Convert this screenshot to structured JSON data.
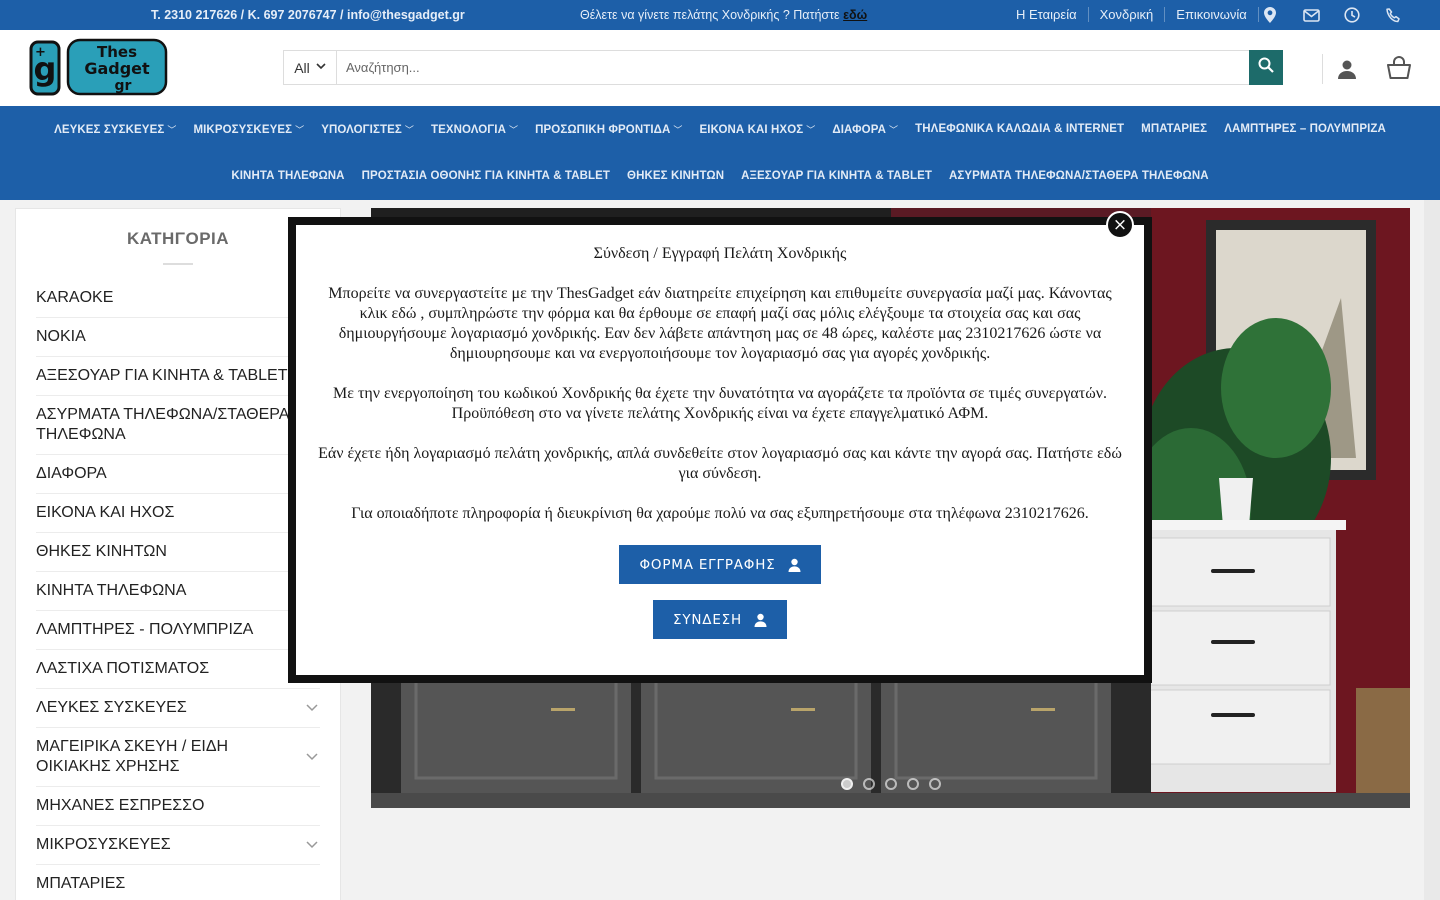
{
  "topbar": {
    "contact": "T. 2310 217626 / K. 697 2076747 / info@thesgadget.gr",
    "wholesale_prompt": "Θέλετε να γίνετε πελάτης Χονδρικής ? Πατήστε",
    "wholesale_link": "εδώ",
    "links": [
      "Η Εταιρεία",
      "Χονδρική",
      "Επικοινωνία"
    ],
    "icons": [
      "location-icon",
      "mail-icon",
      "clock-icon",
      "phone-icon"
    ]
  },
  "header": {
    "logo_text": [
      "Thes",
      "Gadget",
      "gr"
    ],
    "search_category": "All",
    "search_placeholder": "Αναζήτηση..."
  },
  "nav": {
    "row1": [
      {
        "label": "ΛΕΥΚΕΣ ΣΥΣΚΕΥΕΣ",
        "dropdown": true
      },
      {
        "label": "ΜΙΚΡΟΣΥΣΚΕΥΕΣ",
        "dropdown": true
      },
      {
        "label": "ΥΠΟΛΟΓΙΣΤΕΣ",
        "dropdown": true
      },
      {
        "label": "ΤΕΧΝΟΛΟΓΙΑ",
        "dropdown": true
      },
      {
        "label": "ΠΡΟΣΩΠΙΚΗ ΦΡΟΝΤΙΔΑ",
        "dropdown": true
      },
      {
        "label": "ΕΙΚΟΝΑ ΚΑΙ ΗΧΟΣ",
        "dropdown": true
      },
      {
        "label": "ΔΙΑΦΟΡΑ",
        "dropdown": true
      },
      {
        "label": "ΤΗΛΕΦΩΝΙΚΑ ΚΑΛΩΔΙΑ & INTERNET",
        "dropdown": false
      },
      {
        "label": "ΜΠΑΤΑΡΙΕΣ",
        "dropdown": false
      },
      {
        "label": "ΛΑΜΠΤΗΡΕΣ – ΠΟΛΥΜΠΡΙΖΑ",
        "dropdown": false
      }
    ],
    "row2": [
      {
        "label": "ΚΙΝΗΤΑ ΤΗΛΕΦΩΝΑ"
      },
      {
        "label": "ΠΡΟΣΤΑΣΙΑ ΟΘΟΝΗΣ ΓΙΑ ΚΙΝΗΤΑ & TABLET"
      },
      {
        "label": "ΘΗΚΕΣ ΚΙΝΗΤΩΝ"
      },
      {
        "label": "ΑΞΕΣΟΥΑΡ ΓΙΑ ΚΙΝΗΤΑ & TABLET"
      },
      {
        "label": "ΑΣΥΡΜΑΤΑ ΤΗΛΕΦΩΝΑ/ΣΤΑΘΕΡΑ ΤΗΛΕΦΩΝΑ"
      }
    ]
  },
  "sidebar": {
    "title": "ΚΑΤΗΓΟΡΙΑ",
    "items": [
      {
        "label": "KARAOKE",
        "toggle": false
      },
      {
        "label": "NOKIA",
        "toggle": false
      },
      {
        "label": "ΑΞΕΣΟΥΑΡ ΓΙΑ ΚΙΝΗΤΑ & TABLET",
        "toggle": false
      },
      {
        "label": "ΑΣΥΡΜΑΤΑ ΤΗΛΕΦΩΝΑ/ΣΤΑΘΕΡΑ ΤΗΛΕΦΩΝΑ",
        "toggle": false
      },
      {
        "label": "ΔΙΑΦΟΡΑ",
        "toggle": false
      },
      {
        "label": "ΕΙΚΟΝΑ ΚΑΙ ΗΧΟΣ",
        "toggle": false
      },
      {
        "label": "ΘΗΚΕΣ ΚΙΝΗΤΩΝ",
        "toggle": false
      },
      {
        "label": "ΚΙΝΗΤΑ ΤΗΛΕΦΩΝΑ",
        "toggle": false
      },
      {
        "label": "ΛΑΜΠΤΗΡΕΣ - ΠΟΛΥΜΠΡΙΖΑ",
        "toggle": false
      },
      {
        "label": "ΛΑΣΤΙΧΑ ΠΟΤΙΣΜΑΤΟΣ",
        "toggle": false
      },
      {
        "label": "ΛΕΥΚΕΣ ΣΥΣΚΕΥΕΣ",
        "toggle": true
      },
      {
        "label": "ΜΑΓΕΙΡΙΚΑ ΣΚΕΥΗ / ΕΙΔΗ ΟΙΚΙΑΚΗΣ ΧΡΗΣΗΣ",
        "toggle": true
      },
      {
        "label": "ΜΗΧΑΝΕΣ ΕΣΠΡΕΣΣΟ",
        "toggle": false
      },
      {
        "label": "ΜΙΚΡΟΣΥΣΚΕΥΕΣ",
        "toggle": true
      },
      {
        "label": "ΜΠΑΤΑΡΙΕΣ",
        "toggle": false
      }
    ]
  },
  "slider": {
    "dots": 5,
    "active_dot": 0
  },
  "modal": {
    "title": "Σύνδεση / Εγγραφή Πελάτη Χονδρικής",
    "para1": "Μπορείτε να συνεργαστείτε με την ThesGadget εάν διατηρείτε επιχείρηση και επιθυμείτε συνεργασία μαζί μας. Κάνοντας κλικ εδώ , συμπληρώστε την φόρμα και θα έρθουμε σε επαφή μαζί σας μόλις ελέγξουμε τα στοιχεία σας και σας δημιουργήσουμε λογαριασμό χονδρικής. Εαν δεν λάβετε απάντηση μας σε 48 ώρες, καλέστε μας 2310217626 ώστε να δημιουρησουμε και να ενεργοποιήσουμε τον λογαριασμό σας για αγορές χονδρικής.",
    "para2": "Με την ενεργοποίηση του κωδικού Χονδρικής θα έχετε την δυνατότητα να αγοράζετε τα προϊόντα σε τιμές συνεργατών. Προϋπόθεση στο να γίνετε πελάτης Χονδρικής είναι να έχετε επαγγελματικό ΑΦΜ.",
    "para3": "Εάν έχετε ήδη λογαριασμό πελάτη χονδρικής, απλά συνδεθείτε στον λογαριασμό σας και κάντε την αγορά σας. Πατήστε εδώ για σύνδεση.",
    "para4": "Για οποιαδήποτε πληροφορία ή διευκρίνιση θα χαρούμε πολύ να σας εξυπηρετήσουμε στα τηλέφωνα 2310217626.",
    "register_button": "ΦΟΡΜΑ ΕΓΓΡΑΦΗΣ",
    "login_button": "ΣΥΝΔΕΣΗ",
    "close_glyph": "×"
  },
  "colors": {
    "brand_blue": "#1d5fa8",
    "search_button": "#1d6b6a"
  }
}
